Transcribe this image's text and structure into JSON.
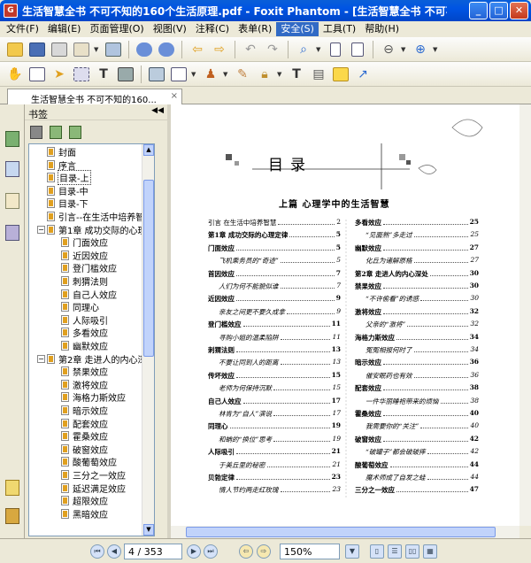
{
  "window": {
    "title": "生活智慧全书  不可不知的160个生活原理.pdf - Foxit Phantom - [生活智慧全书  不可不...",
    "min": "_",
    "max": "□",
    "close": "✕"
  },
  "menu": [
    "文件(F)",
    "编辑(E)",
    "页面管理(O)",
    "视图(V)",
    "注释(C)",
    "表单(R)",
    "安全(S)",
    "工具(T)",
    "帮助(H)"
  ],
  "active_menu_index": 6,
  "tab": {
    "label": "生活智慧全书  不可不知的160...",
    "close": "×"
  },
  "panel": {
    "title": "书签",
    "collapse": "◀◀"
  },
  "bookmarks": [
    {
      "label": "封面",
      "level": 0
    },
    {
      "label": "序言",
      "level": 0
    },
    {
      "label": "目录-上",
      "level": 0,
      "selected": true
    },
    {
      "label": "目录-中",
      "level": 0
    },
    {
      "label": "目录-下",
      "level": 0
    },
    {
      "label": "引言--在生活中培养智慧",
      "level": 0
    },
    {
      "label": "第1章 成功交际的心理定律",
      "level": 0,
      "expander": "−"
    },
    {
      "label": "门面效应",
      "level": 1
    },
    {
      "label": "近因效应",
      "level": 1
    },
    {
      "label": "登门槛效应",
      "level": 1
    },
    {
      "label": "刺猬法则",
      "level": 1
    },
    {
      "label": "自己人效应",
      "level": 1
    },
    {
      "label": "同理心",
      "level": 1
    },
    {
      "label": "人际吸引",
      "level": 1
    },
    {
      "label": "多看效应",
      "level": 1
    },
    {
      "label": "幽默效应",
      "level": 1
    },
    {
      "label": "第2章 走进人的内心深处",
      "level": 0,
      "expander": "−"
    },
    {
      "label": "禁果效应",
      "level": 1
    },
    {
      "label": "激将效应",
      "level": 1
    },
    {
      "label": "海格力斯效应",
      "level": 1
    },
    {
      "label": "暗示效应",
      "level": 1
    },
    {
      "label": "配套效应",
      "level": 1
    },
    {
      "label": "霍桑效应",
      "level": 1
    },
    {
      "label": "破窗效应",
      "level": 1
    },
    {
      "label": "酸葡萄效应",
      "level": 1
    },
    {
      "label": "三分之一效应",
      "level": 1
    },
    {
      "label": "延迟满足效应",
      "level": 1
    },
    {
      "label": "超限效应",
      "level": 1
    },
    {
      "label": "黑暗效应",
      "level": 1
    }
  ],
  "document": {
    "toc_title": "目录",
    "part_title": "上篇    心理学中的生活智慧",
    "left_col": [
      {
        "text": "引言  在生活中培养智慧",
        "page": "2",
        "style": "plain"
      },
      {
        "text": "第1章  成功交际的心理定律",
        "page": "5",
        "style": "bold"
      },
      {
        "text": "门面效应",
        "page": "5",
        "style": "bold"
      },
      {
        "text": "飞机乘务员的“奇迹”",
        "page": "5",
        "style": "italic"
      },
      {
        "text": "首因效应",
        "page": "7",
        "style": "bold"
      },
      {
        "text": "人们为何不能貌似谁",
        "page": "7",
        "style": "italic"
      },
      {
        "text": "近因效应",
        "page": "9",
        "style": "bold"
      },
      {
        "text": "亲友之间更不要久成拿",
        "page": "9",
        "style": "italic"
      },
      {
        "text": "登门槛效应",
        "page": "11",
        "style": "bold"
      },
      {
        "text": "寻购小姐的温柔陷阱",
        "page": "11",
        "style": "italic"
      },
      {
        "text": "刺猬法则",
        "page": "13",
        "style": "bold"
      },
      {
        "text": "不要让同到人的距离",
        "page": "13",
        "style": "italic"
      },
      {
        "text": "传坏效应",
        "page": "15",
        "style": "bold"
      },
      {
        "text": "老师为何保持沉默",
        "page": "15",
        "style": "italic"
      },
      {
        "text": "自己人效应",
        "page": "17",
        "style": "bold"
      },
      {
        "text": "林肯为“自人”演说",
        "page": "17",
        "style": "italic"
      },
      {
        "text": "同理心",
        "page": "19",
        "style": "bold"
      },
      {
        "text": "和蚺的“换位”思考",
        "page": "19",
        "style": "italic"
      },
      {
        "text": "人际吸引",
        "page": "21",
        "style": "bold"
      },
      {
        "text": "于美丘里的秘密",
        "page": "21",
        "style": "italic"
      },
      {
        "text": "贝勃定律",
        "page": "23",
        "style": "bold"
      },
      {
        "text": "情人节约两走红玫瑰",
        "page": "23",
        "style": "italic"
      }
    ],
    "right_col": [
      {
        "text": "多看效应",
        "page": "25",
        "style": "bold"
      },
      {
        "text": "“见面熟”多走过",
        "page": "25",
        "style": "italic"
      },
      {
        "text": "幽默效应",
        "page": "27",
        "style": "bold"
      },
      {
        "text": "化丘为诸解原格",
        "page": "27",
        "style": "italic"
      },
      {
        "text": "第2章  走进人的内心深处",
        "page": "30",
        "style": "bold"
      },
      {
        "text": "禁果效应",
        "page": "30",
        "style": "bold"
      },
      {
        "text": "“不许偷看”的诱惑",
        "page": "30",
        "style": "italic"
      },
      {
        "text": "激将效应",
        "page": "32",
        "style": "bold"
      },
      {
        "text": "父亲的“激将”",
        "page": "32",
        "style": "italic"
      },
      {
        "text": "海格力斯效应",
        "page": "34",
        "style": "bold"
      },
      {
        "text": "冤冤相报何时了",
        "page": "34",
        "style": "italic"
      },
      {
        "text": "暗示效应",
        "page": "36",
        "style": "bold"
      },
      {
        "text": "催安眠药也有效",
        "page": "36",
        "style": "italic"
      },
      {
        "text": "配套效应",
        "page": "38",
        "style": "bold"
      },
      {
        "text": "一件华丽睡袍带来的烦恼",
        "page": "38",
        "style": "italic"
      },
      {
        "text": "霍桑效应",
        "page": "40",
        "style": "bold"
      },
      {
        "text": "我需要你的“关注”",
        "page": "40",
        "style": "italic"
      },
      {
        "text": "破窗效应",
        "page": "42",
        "style": "bold"
      },
      {
        "text": "“破罐子”都会破破摔",
        "page": "42",
        "style": "italic"
      },
      {
        "text": "酸葡萄效应",
        "page": "44",
        "style": "bold"
      },
      {
        "text": "魔术师成了自发之蛙",
        "page": "44",
        "style": "italic"
      },
      {
        "text": "三分之一效应",
        "page": "47",
        "style": "bold"
      }
    ]
  },
  "status": {
    "page": "4 / 353",
    "zoom": "150%"
  }
}
